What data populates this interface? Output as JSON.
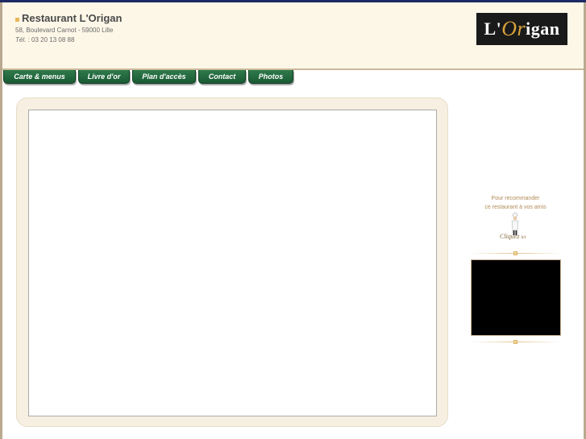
{
  "header": {
    "title": "Restaurant L'Origan",
    "address": "58, Boulevard Carnot - 59000 Lille",
    "tel_label": "Tél.",
    "tel_value": ": 03 20 13 08 88"
  },
  "logo": {
    "prefix": "L'",
    "accent": "Or",
    "suffix": "igan"
  },
  "nav": {
    "items": [
      {
        "label": "Carte & menus"
      },
      {
        "label": "Livre d'or"
      },
      {
        "label": "Plan d'accès"
      },
      {
        "label": "Contact"
      },
      {
        "label": "Photos"
      }
    ]
  },
  "sidebar": {
    "recommend_line1": "Pour recommander",
    "recommend_line2": "ce restaurant à vos amis",
    "click_text": "Cliquez",
    "click_small": "ici"
  },
  "colors": {
    "top_bar": "#1e2a63",
    "tab_green": "#1a5a34",
    "header_bg": "#fdf7e8",
    "panel_bg": "#f7f0e2",
    "accent_gold": "#d8a23a"
  }
}
